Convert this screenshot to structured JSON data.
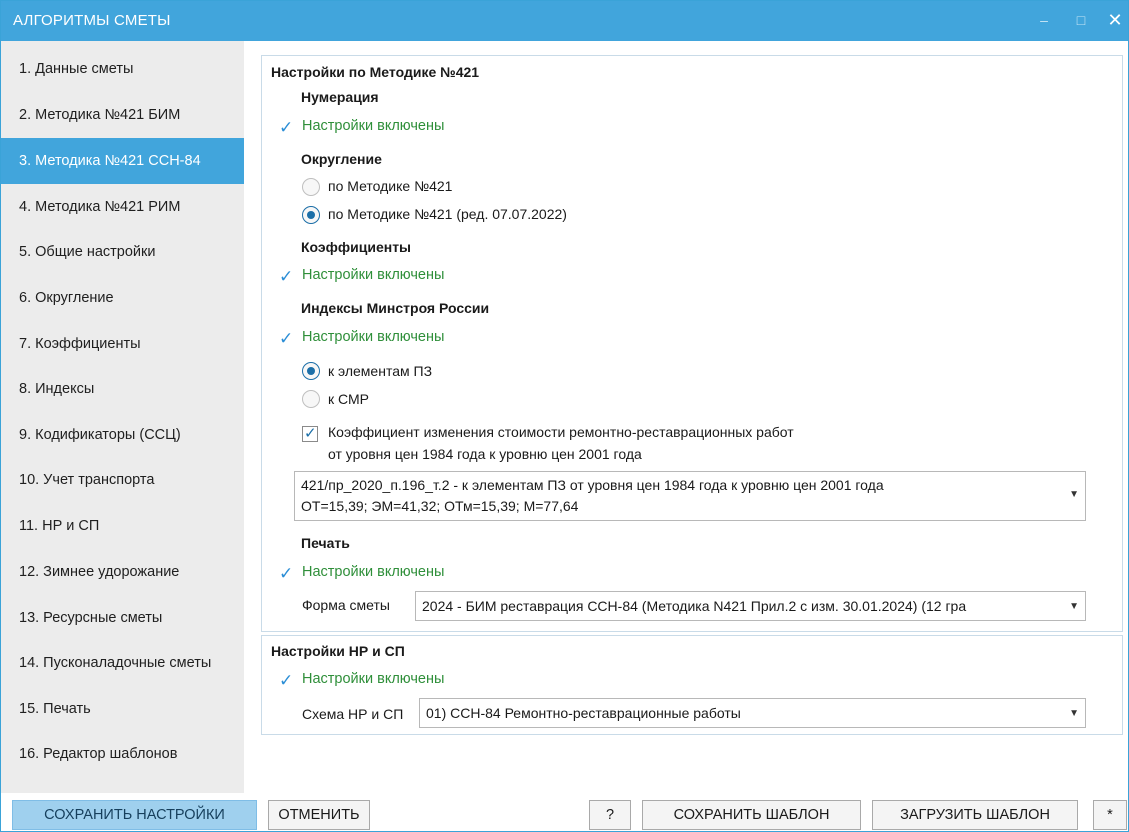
{
  "window": {
    "title": "АЛГОРИТМЫ СМЕТЫ",
    "min_glyph": "–",
    "max_glyph": "□",
    "close_glyph": "✕"
  },
  "sidebar": {
    "items": [
      {
        "label": "1. Данные сметы"
      },
      {
        "label": "2. Методика №421 БИМ"
      },
      {
        "label": "3. Методика №421 ССН-84",
        "active": true
      },
      {
        "label": "4. Методика №421 РИМ"
      },
      {
        "label": "5. Общие настройки"
      },
      {
        "label": "6. Округление"
      },
      {
        "label": "7. Коэффициенты"
      },
      {
        "label": "8. Индексы"
      },
      {
        "label": "9. Кодификаторы (ССЦ)"
      },
      {
        "label": "10. Учет транспорта"
      },
      {
        "label": "11. НР и СП"
      },
      {
        "label": "12. Зимнее удорожание"
      },
      {
        "label": "13. Ресурсные сметы"
      },
      {
        "label": "14. Пусконаладочные сметы"
      },
      {
        "label": "15. Печать"
      },
      {
        "label": "16. Редактор шаблонов"
      }
    ]
  },
  "panel1": {
    "title": "Настройки по Методике №421",
    "numbering": {
      "heading": "Нумерация",
      "status": "Настройки включены"
    },
    "rounding": {
      "heading": "Округление",
      "option1": "по Методике №421",
      "option2": "по Методике №421 (ред. 07.07.2022)",
      "selected": 2
    },
    "coefficients": {
      "heading": "Коэффициенты",
      "status": "Настройки включены"
    },
    "indexes": {
      "heading": "Индексы Минстроя России",
      "status": "Настройки включены",
      "option1": "к элементам ПЗ",
      "option2": "к СМР",
      "selected": 1,
      "checkbox_checked": true,
      "checkbox_line1": "Коэффициент изменения стоимости ремонтно-реставрационных работ",
      "checkbox_line2": "от уровня цен 1984 года к уровню цен 2001 года",
      "select_line1": "421/пр_2020_п.196_т.2 - к элементам ПЗ от уровня цен 1984 года к уровню цен 2001 года",
      "select_line2": "ОТ=15,39; ЭМ=41,32; ОТм=15,39; М=77,64"
    },
    "print": {
      "heading": "Печать",
      "status": "Настройки включены",
      "form_label": "Форма сметы",
      "form_value": "2024 - БИМ реставрация ССН-84 (Методика N421 Прил.2 с изм. 30.01.2024) (12 гра"
    }
  },
  "panel2": {
    "title": "Настройки НР и СП",
    "status": "Настройки включены",
    "scheme_label": "Схема НР и СП",
    "scheme_value": "01) ССН-84 Ремонтно-реставрационные работы"
  },
  "footer": {
    "save_settings": "СОХРАНИТЬ НАСТРОЙКИ",
    "cancel": "ОТМЕНИТЬ",
    "help": "?",
    "save_template": "СОХРАНИТЬ ШАБЛОН",
    "load_template": "ЗАГРУЗИТЬ ШАБЛОН",
    "star": "*"
  },
  "glyphs": {
    "check": "✓",
    "dropdown_arrow": "▼"
  },
  "colors": {
    "accent": "#41a5dc",
    "active_nav": "#41a5dc",
    "enabled_text": "#2f8f3a",
    "check_blue": "#2b8ed6",
    "primary_button": "#9fd0ee"
  }
}
